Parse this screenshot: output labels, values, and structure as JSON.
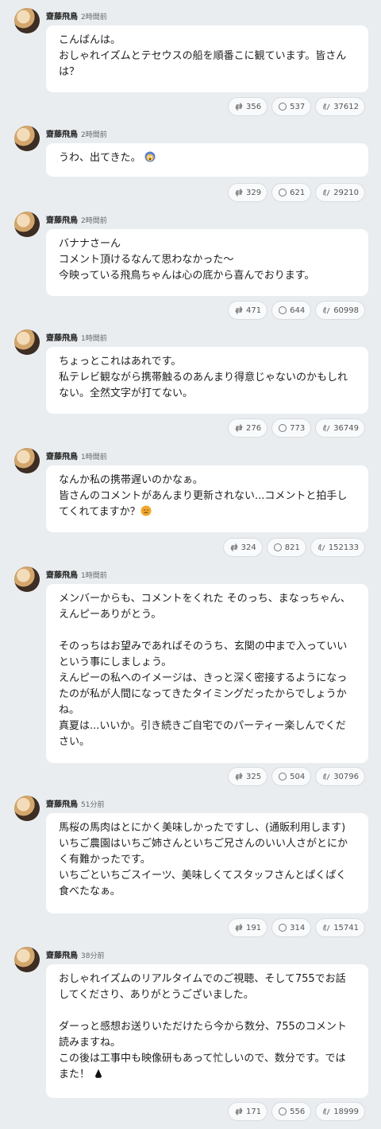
{
  "posts": [
    {
      "author": "齋藤飛鳥",
      "time": "2時間前",
      "text": "こんばんは。\nおしゃれイズムとテセウスの船を順番こに観ています。皆さんは？",
      "retweets": "356",
      "comments": "537",
      "claps": "37612",
      "emoji": ""
    },
    {
      "author": "齋藤飛鳥",
      "time": "2時間前",
      "text": "うわ、出てきた。",
      "retweets": "329",
      "comments": "621",
      "claps": "29210",
      "emoji": "scream"
    },
    {
      "author": "齋藤飛鳥",
      "time": "2時間前",
      "text": "バナナさーん\nコメント頂けるなんて思わなかった〜\n今映っている飛鳥ちゃんは心の底から喜んでおります。",
      "retweets": "471",
      "comments": "644",
      "claps": "60998",
      "emoji": ""
    },
    {
      "author": "齋藤飛鳥",
      "time": "1時間前",
      "text": "ちょっとこれはあれです。\n私テレビ観ながら携帯触るのあんまり得意じゃないのかもしれない。全然文字が打てない。",
      "retweets": "276",
      "comments": "773",
      "claps": "36749",
      "emoji": ""
    },
    {
      "author": "齋藤飛鳥",
      "time": "1時間前",
      "text": "なんか私の携帯遅いのかなぁ。\n皆さんのコメントがあんまり更新されない...コメントと拍手してくれてますか？",
      "retweets": "324",
      "comments": "821",
      "claps": "152133",
      "emoji": "worried"
    },
    {
      "author": "齋藤飛鳥",
      "time": "1時間前",
      "text": "メンバーからも、コメントをくれた そのっち、まなっちゃん、えんピーありがとう。\n\nそのっちはお望みであればそのうち、玄関の中まで入っていいという事にしましょう。\nえんピーの私へのイメージは、きっと深く密接するようになったのが私が人間になってきたタイミングだったからでしょうかね。\n真夏は...いいか。引き続きご自宅でのパーティー楽しんでください。",
      "retweets": "325",
      "comments": "504",
      "claps": "30796",
      "emoji": ""
    },
    {
      "author": "齋藤飛鳥",
      "time": "51分前",
      "text": "馬桜の馬肉はとにかく美味しかったですし、(通販利用します)\nいちご農園はいちご姉さんといちご兄さんのいい人さがとにかく有難かったです。\nいちごといちごスイーツ、美味しくてスタッフさんとぱくぱく食べたなぁ。",
      "retweets": "191",
      "comments": "314",
      "claps": "15741",
      "emoji": ""
    },
    {
      "author": "齋藤飛鳥",
      "time": "38分前",
      "text": "おしゃれイズムのリアルタイムでのご視聴、そして755でお話してくださり、ありがとうございました。\n\nダーっと感想お送りいただけたら今から数分、755のコメント読みますね。\nこの後は工事中も映像研もあって忙しいので、数分です。では また！",
      "retweets": "171",
      "comments": "556",
      "claps": "18999",
      "emoji": "bell"
    }
  ]
}
